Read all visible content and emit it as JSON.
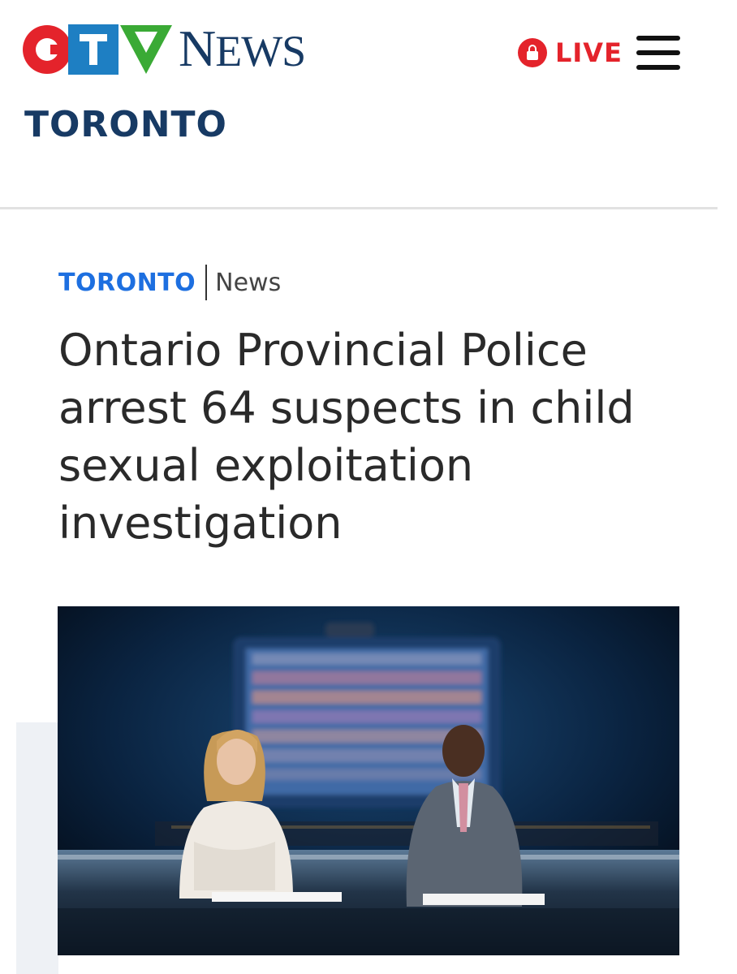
{
  "header": {
    "logo_text": "CTV NEWS",
    "live_label": "LIVE",
    "section_title": "TORONTO"
  },
  "article": {
    "breadcrumb_section": "TORONTO",
    "breadcrumb_type": "News",
    "headline": "Ontario Provincial Police arrest 64 suspects in child sexual exploitation investigation"
  },
  "colors": {
    "ctv_red": "#e4232b",
    "ctv_blue": "#1e7fc3",
    "ctv_green": "#3aaa35",
    "news_navy": "#173a64",
    "breadcrumb_blue": "#1d6fe0"
  },
  "icons": [
    "lock-icon",
    "hamburger-menu-icon"
  ]
}
